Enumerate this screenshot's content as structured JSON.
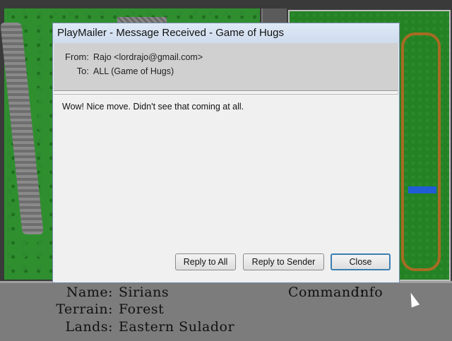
{
  "dialog": {
    "title": "PlayMailer - Message Received - Game of Hugs",
    "from_label": "From:",
    "from_value": "Rajo <lordrajo@gmail.com>",
    "to_label": "To:",
    "to_value": "ALL (Game of Hugs)",
    "message": "Wow! Nice move. Didn't see that coming at all.",
    "buttons": {
      "reply_all": "Reply to All",
      "reply_sender": "Reply to Sender",
      "close": "Close"
    }
  },
  "status": {
    "name_label": "Name:",
    "name_value": "Sirians",
    "terrain_label": "Terrain:",
    "terrain_value": "Forest",
    "lands_label": "Lands:",
    "lands_value": "Eastern Sulador",
    "command_label": "Command:",
    "command_value": "Info"
  },
  "colors": {
    "forest": "#2f8f2f",
    "status_bg": "#7c7c7c",
    "dialog_bg": "#d0d0d0",
    "button_focus": "#3c7fb1"
  }
}
